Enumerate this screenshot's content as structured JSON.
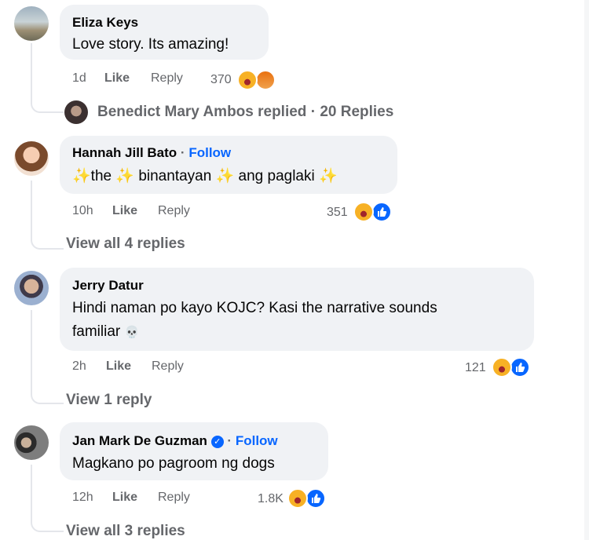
{
  "comments": [
    {
      "author": "Eliza Keys",
      "text": "Love story. Its amazing!",
      "time": "1d",
      "like_label": "Like",
      "reply_label": "Reply",
      "reaction_count": "370",
      "reactions": [
        "haha",
        "angry"
      ],
      "replies_summary": {
        "replier": "Benedict Mary Ambos replied",
        "separator": "·",
        "count": "20 Replies"
      }
    },
    {
      "author": "Hannah Jill Bato",
      "separator": "·",
      "follow_label": "Follow",
      "text_parts": [
        "✨",
        "the",
        "✨",
        "binantayan",
        "✨",
        "ang paglaki",
        "✨"
      ],
      "time": "10h",
      "like_label": "Like",
      "reply_label": "Reply",
      "reaction_count": "351",
      "reactions": [
        "haha",
        "like"
      ],
      "view_replies": "View all 4 replies"
    },
    {
      "author": "Jerry Datur",
      "text_line1": "Hindi naman po kayo KOJC? Kasi the narrative sounds",
      "text_line2": "familiar",
      "emoji": "💀",
      "time": "2h",
      "like_label": "Like",
      "reply_label": "Reply",
      "reaction_count": "121",
      "reactions": [
        "haha",
        "like"
      ],
      "view_replies": "View 1 reply"
    },
    {
      "author": "Jan Mark De Guzman",
      "verified_icon": "check",
      "separator": "·",
      "follow_label": "Follow",
      "text": "Magkano po pagroom ng dogs",
      "time": "12h",
      "like_label": "Like",
      "reply_label": "Reply",
      "reaction_count": "1.8K",
      "reactions": [
        "haha",
        "like"
      ],
      "view_replies": "View all 3 replies"
    }
  ],
  "colors": {
    "bubble": "#f0f2f5",
    "link_blue": "#0866ff",
    "meta_gray": "#65676b"
  }
}
